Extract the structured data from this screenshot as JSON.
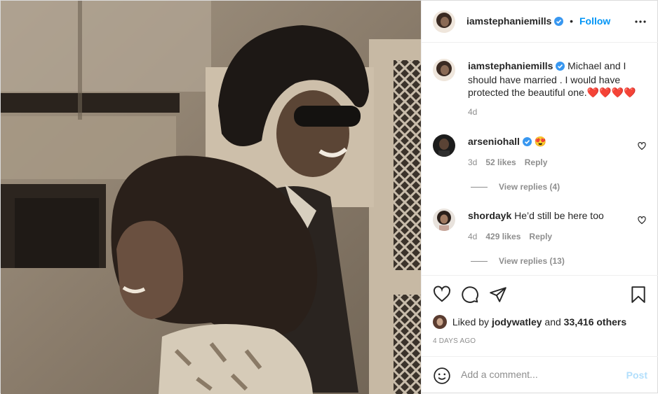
{
  "post": {
    "author": "iamstephaniemills",
    "follow_label": "Follow",
    "dot": "•",
    "photo_description_icon": "photo"
  },
  "caption": {
    "username": "iamstephaniemills",
    "text": "Michael and I should have married . I would have protected the beautiful one.",
    "emoji": "❤️❤️❤️❤️",
    "age": "4d"
  },
  "comments": [
    {
      "username": "arseniohall",
      "verified": true,
      "text": "😍",
      "age": "3d",
      "likes": "52 likes",
      "reply_label": "Reply",
      "view_replies": "View replies (4)"
    },
    {
      "username": "shordayk",
      "verified": false,
      "text": "He’d still be here too",
      "age": "4d",
      "likes": "429 likes",
      "reply_label": "Reply",
      "view_replies": "View replies (13)"
    }
  ],
  "liked_by": {
    "prefix": "Liked by",
    "user": "jodywatley",
    "joiner": "and",
    "others": "33,416 others"
  },
  "date_label": "4 DAYS AGO",
  "add_comment": {
    "placeholder": "Add a comment...",
    "post_label": "Post"
  },
  "colors": {
    "accent": "#0095f6",
    "verified": "#3897f0",
    "muted": "#8e8e8e",
    "post_disabled": "#b2dffc"
  }
}
